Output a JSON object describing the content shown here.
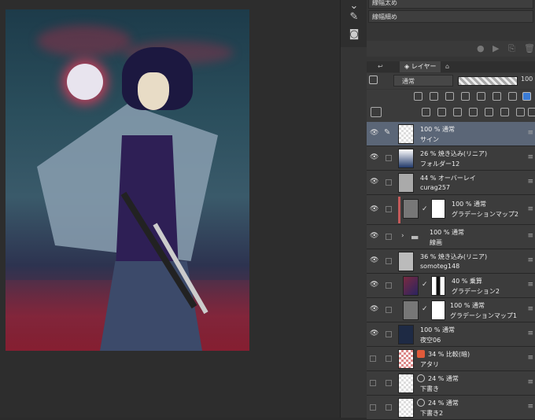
{
  "brush_sizes": [
    "線幅太め",
    "線幅細め"
  ],
  "layer_panel": {
    "tab_label": "レイヤー",
    "blend_mode": "通常",
    "opacity_value": "100"
  },
  "layers": [
    {
      "opacity_blend": "100 % 通常",
      "name": "サイン",
      "selected": true,
      "thumb": "checker"
    },
    {
      "opacity_blend": "26 % 焼き込み(リニア)",
      "name": "フォルダー12",
      "thumb": "figure"
    },
    {
      "opacity_blend": "44 % オーバーレイ",
      "name": "curag257",
      "thumb": "gray"
    },
    {
      "opacity_blend": "100 % 通常",
      "name": "グラデーションマップ2",
      "thumb": "gray"
    },
    {
      "opacity_blend": "100 % 通常",
      "name": "線画",
      "thumb": "folder"
    },
    {
      "opacity_blend": "36 % 焼き込み(リニア)",
      "name": "somoteg148",
      "thumb": "gray"
    },
    {
      "opacity_blend": "40 % 乗算",
      "name": "グラデーション2",
      "thumb": "gray"
    },
    {
      "opacity_blend": "100 % 通常",
      "name": "グラデーションマップ1",
      "thumb": "gray"
    },
    {
      "opacity_blend": "100 % 通常",
      "name": "夜空06",
      "thumb": "dark"
    },
    {
      "opacity_blend": "34 % 比較(暗)",
      "name": "アタリ",
      "thumb": "checker"
    },
    {
      "opacity_blend": "24 % 通常",
      "name": "下書き",
      "thumb": "checker"
    },
    {
      "opacity_blend": "24 % 通常",
      "name": "下書き2",
      "thumb": "checker"
    }
  ]
}
